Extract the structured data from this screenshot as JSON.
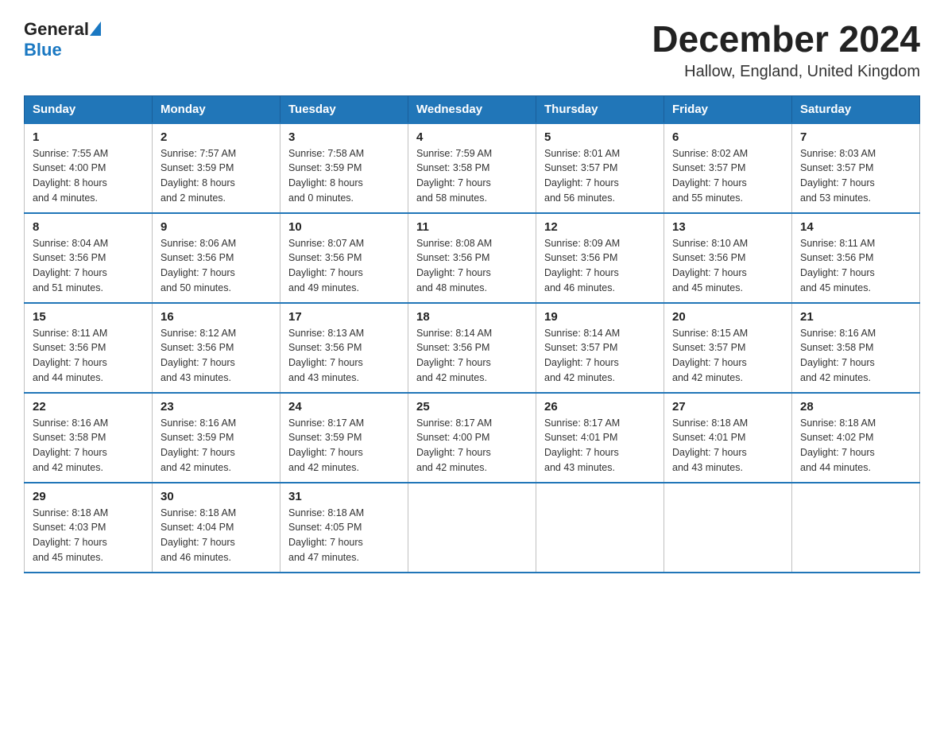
{
  "header": {
    "logo_general": "General",
    "logo_blue": "Blue",
    "title": "December 2024",
    "subtitle": "Hallow, England, United Kingdom"
  },
  "columns": [
    "Sunday",
    "Monday",
    "Tuesday",
    "Wednesday",
    "Thursday",
    "Friday",
    "Saturday"
  ],
  "weeks": [
    [
      {
        "day": "1",
        "sunrise": "7:55 AM",
        "sunset": "4:00 PM",
        "daylight": "8 hours and 4 minutes."
      },
      {
        "day": "2",
        "sunrise": "7:57 AM",
        "sunset": "3:59 PM",
        "daylight": "8 hours and 2 minutes."
      },
      {
        "day": "3",
        "sunrise": "7:58 AM",
        "sunset": "3:59 PM",
        "daylight": "8 hours and 0 minutes."
      },
      {
        "day": "4",
        "sunrise": "7:59 AM",
        "sunset": "3:58 PM",
        "daylight": "7 hours and 58 minutes."
      },
      {
        "day": "5",
        "sunrise": "8:01 AM",
        "sunset": "3:57 PM",
        "daylight": "7 hours and 56 minutes."
      },
      {
        "day": "6",
        "sunrise": "8:02 AM",
        "sunset": "3:57 PM",
        "daylight": "7 hours and 55 minutes."
      },
      {
        "day": "7",
        "sunrise": "8:03 AM",
        "sunset": "3:57 PM",
        "daylight": "7 hours and 53 minutes."
      }
    ],
    [
      {
        "day": "8",
        "sunrise": "8:04 AM",
        "sunset": "3:56 PM",
        "daylight": "7 hours and 51 minutes."
      },
      {
        "day": "9",
        "sunrise": "8:06 AM",
        "sunset": "3:56 PM",
        "daylight": "7 hours and 50 minutes."
      },
      {
        "day": "10",
        "sunrise": "8:07 AM",
        "sunset": "3:56 PM",
        "daylight": "7 hours and 49 minutes."
      },
      {
        "day": "11",
        "sunrise": "8:08 AM",
        "sunset": "3:56 PM",
        "daylight": "7 hours and 48 minutes."
      },
      {
        "day": "12",
        "sunrise": "8:09 AM",
        "sunset": "3:56 PM",
        "daylight": "7 hours and 46 minutes."
      },
      {
        "day": "13",
        "sunrise": "8:10 AM",
        "sunset": "3:56 PM",
        "daylight": "7 hours and 45 minutes."
      },
      {
        "day": "14",
        "sunrise": "8:11 AM",
        "sunset": "3:56 PM",
        "daylight": "7 hours and 45 minutes."
      }
    ],
    [
      {
        "day": "15",
        "sunrise": "8:11 AM",
        "sunset": "3:56 PM",
        "daylight": "7 hours and 44 minutes."
      },
      {
        "day": "16",
        "sunrise": "8:12 AM",
        "sunset": "3:56 PM",
        "daylight": "7 hours and 43 minutes."
      },
      {
        "day": "17",
        "sunrise": "8:13 AM",
        "sunset": "3:56 PM",
        "daylight": "7 hours and 43 minutes."
      },
      {
        "day": "18",
        "sunrise": "8:14 AM",
        "sunset": "3:56 PM",
        "daylight": "7 hours and 42 minutes."
      },
      {
        "day": "19",
        "sunrise": "8:14 AM",
        "sunset": "3:57 PM",
        "daylight": "7 hours and 42 minutes."
      },
      {
        "day": "20",
        "sunrise": "8:15 AM",
        "sunset": "3:57 PM",
        "daylight": "7 hours and 42 minutes."
      },
      {
        "day": "21",
        "sunrise": "8:16 AM",
        "sunset": "3:58 PM",
        "daylight": "7 hours and 42 minutes."
      }
    ],
    [
      {
        "day": "22",
        "sunrise": "8:16 AM",
        "sunset": "3:58 PM",
        "daylight": "7 hours and 42 minutes."
      },
      {
        "day": "23",
        "sunrise": "8:16 AM",
        "sunset": "3:59 PM",
        "daylight": "7 hours and 42 minutes."
      },
      {
        "day": "24",
        "sunrise": "8:17 AM",
        "sunset": "3:59 PM",
        "daylight": "7 hours and 42 minutes."
      },
      {
        "day": "25",
        "sunrise": "8:17 AM",
        "sunset": "4:00 PM",
        "daylight": "7 hours and 42 minutes."
      },
      {
        "day": "26",
        "sunrise": "8:17 AM",
        "sunset": "4:01 PM",
        "daylight": "7 hours and 43 minutes."
      },
      {
        "day": "27",
        "sunrise": "8:18 AM",
        "sunset": "4:01 PM",
        "daylight": "7 hours and 43 minutes."
      },
      {
        "day": "28",
        "sunrise": "8:18 AM",
        "sunset": "4:02 PM",
        "daylight": "7 hours and 44 minutes."
      }
    ],
    [
      {
        "day": "29",
        "sunrise": "8:18 AM",
        "sunset": "4:03 PM",
        "daylight": "7 hours and 45 minutes."
      },
      {
        "day": "30",
        "sunrise": "8:18 AM",
        "sunset": "4:04 PM",
        "daylight": "7 hours and 46 minutes."
      },
      {
        "day": "31",
        "sunrise": "8:18 AM",
        "sunset": "4:05 PM",
        "daylight": "7 hours and 47 minutes."
      },
      null,
      null,
      null,
      null
    ]
  ],
  "labels": {
    "sunrise": "Sunrise:",
    "sunset": "Sunset:",
    "daylight": "Daylight:"
  }
}
